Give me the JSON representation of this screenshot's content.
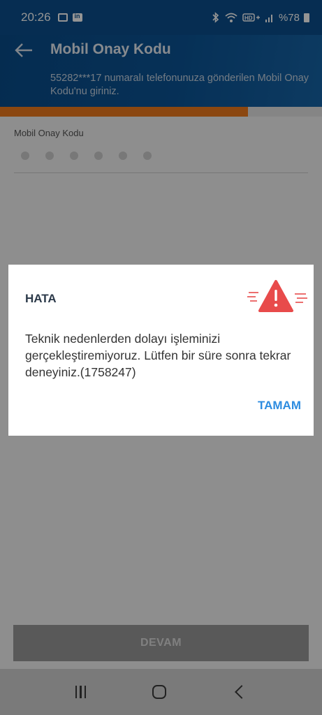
{
  "status_bar": {
    "time": "20:26",
    "right_text": "%78",
    "icons": [
      "message-icon",
      "linkedin-icon",
      "bluetooth-icon",
      "wifi-icon",
      "hd-signal-icon",
      "signal-icon",
      "battery-icon"
    ]
  },
  "header": {
    "title": "Mobil Onay Kodu",
    "subtitle": "55282***17 numaralı telefonunuza gönderilen Mobil Onay Kodu'nu giriniz."
  },
  "progress": {
    "fraction": 0.77,
    "color": "#f07b1c"
  },
  "form": {
    "field_label": "Mobil Onay Kodu",
    "code_length": 6,
    "continue_label": "DEVAM"
  },
  "dialog": {
    "title": "HATA",
    "message": "Teknik nedenlerden dolayı işleminizi gerçekleştiremiyoruz. Lütfen bir süre sonra tekrar deneyiniz.(1758247)",
    "ok_label": "TAMAM",
    "icon": "warning-icon",
    "accent_color": "#e84b4b"
  },
  "colors": {
    "header_bg": "#0b4f8e",
    "link_blue": "#2d8ce0"
  }
}
